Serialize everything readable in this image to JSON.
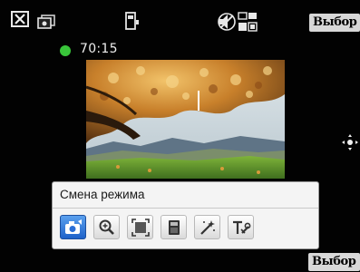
{
  "status_bar": {
    "timer": "70:15",
    "top_softkey_label": "Выбор",
    "icons": [
      "close-icon",
      "gallery-icon",
      "flash-icon",
      "sound-off-icon",
      "white-balance-icon"
    ]
  },
  "viewfinder": {
    "scene": "autumn-tree-landscape"
  },
  "mode_panel": {
    "title": "Смена режима",
    "buttons": [
      {
        "icon": "camera-mode-icon",
        "active": true
      },
      {
        "icon": "zoom-icon",
        "active": false
      },
      {
        "icon": "frame-size-icon",
        "active": false
      },
      {
        "icon": "storage-icon",
        "active": false
      },
      {
        "icon": "effects-wand-icon",
        "active": false
      },
      {
        "icon": "settings-tools-icon",
        "active": false
      }
    ]
  },
  "bottom_softkey_label": "Выбор",
  "colors": {
    "rec_dot": "#39c53a",
    "active_button": "#1f62c9",
    "panel_bg": "#f4f4f4",
    "softkey_bg": "#d8d8d8"
  }
}
